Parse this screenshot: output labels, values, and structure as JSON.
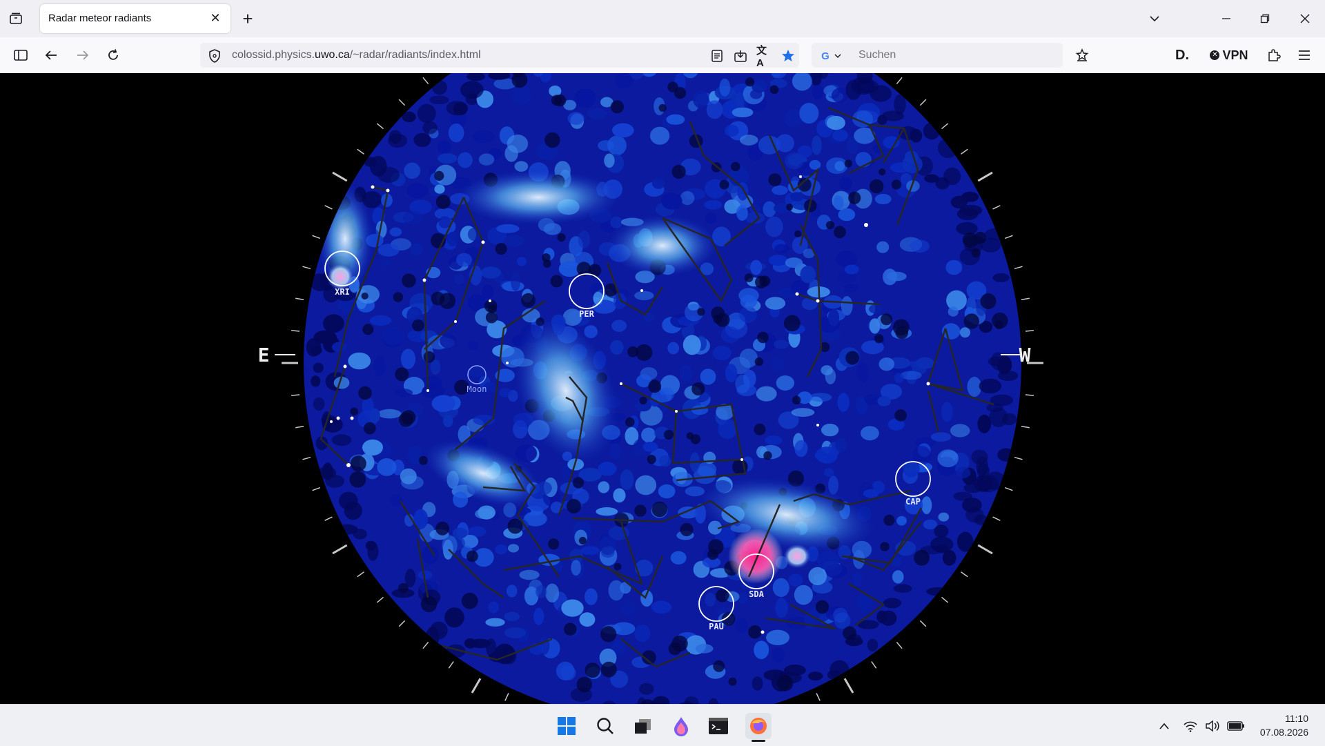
{
  "browser": {
    "tab": {
      "title": "Radar meteor radiants",
      "close": "✕"
    },
    "new_tab": "+",
    "url": {
      "domain_prefix": "colossid.physics.",
      "domain_main": "uwo.ca",
      "path": "/~radar/radiants/index.html"
    },
    "search": {
      "placeholder": "Suchen",
      "engine": "G"
    },
    "vpn_label": "VPN",
    "d_label": "D."
  },
  "sky_map": {
    "compass": {
      "east": "E",
      "west": "W"
    },
    "radiants": [
      {
        "code": "XRI",
        "intensity": "high"
      },
      {
        "code": "PER",
        "intensity": "medium"
      },
      {
        "code": "CAP",
        "intensity": "medium"
      },
      {
        "code": "SDA",
        "intensity": "very-high"
      },
      {
        "code": "PAU",
        "intensity": "medium"
      }
    ],
    "moon_label": "Moon",
    "colors": {
      "background": "#000000",
      "density_low": "#0a1fb8",
      "density_mid": "#3aa0e8",
      "density_high": "#e8f4ff",
      "peak": "#ff1e8c",
      "constellation_lines": "#2a2a2a"
    }
  },
  "taskbar": {
    "time": "11:10",
    "date": "07.08.2026"
  }
}
